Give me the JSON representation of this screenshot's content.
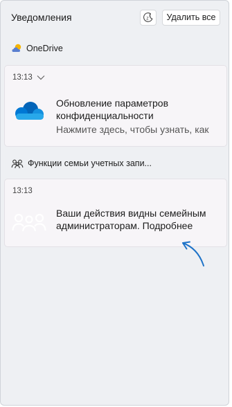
{
  "header": {
    "title": "Уведомления",
    "clear_all_label": "Удалить все"
  },
  "groups": [
    {
      "app_name": "OneDrive",
      "notification": {
        "time": "13:13",
        "title": "Обновление параметров конфиденциальности",
        "subtitle": "Нажмите здесь, чтобы узнать, как"
      }
    },
    {
      "app_name": "Функции семьи учетных запи...",
      "notification": {
        "time": "13:13",
        "title": "Ваши действия видны семейным администраторам. Подробнее"
      }
    }
  ],
  "colors": {
    "panel_bg": "#eef0f3",
    "card_bg": "#f7f5f8",
    "onedrive_blue": "#0078d4",
    "arrow_blue": "#1e73c8"
  }
}
